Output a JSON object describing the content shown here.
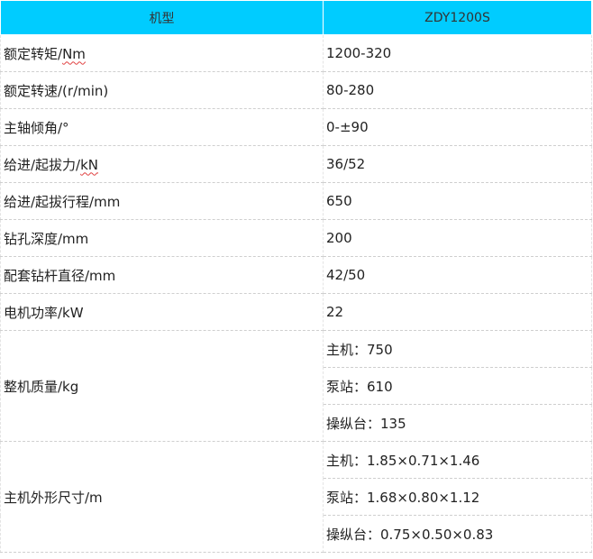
{
  "header": {
    "col1": "机型",
    "col2": "ZDY1200S"
  },
  "rows": [
    {
      "label_prefix": "额定转矩/",
      "label_unit": "Nm",
      "value": "1200-320"
    },
    {
      "label_prefix": "额定转速/(r/min)",
      "value": "80-280"
    },
    {
      "label_prefix": "主轴倾角/°",
      "value": "0-±90"
    },
    {
      "label_prefix": "给进/起拔力/",
      "label_unit": "kN",
      "value": "36/52"
    },
    {
      "label_prefix": "给进/起拔行程/mm",
      "value": "650"
    },
    {
      "label_prefix": "钻孔深度/mm",
      "value": "200"
    },
    {
      "label_prefix": "配套钻杆直径/mm",
      "value": "42/50"
    },
    {
      "label_prefix": "电机功率/kW",
      "value": "22"
    }
  ],
  "mass": {
    "label": "整机质量/kg",
    "values": [
      "主机：750",
      "泵站：610",
      "操纵台：135"
    ]
  },
  "dims": {
    "label": "主机外形尺寸/m",
    "values": [
      "主机：1.85×0.71×1.46",
      "泵站：1.68×0.80×1.12",
      "操纵台：0.75×0.50×0.83"
    ]
  }
}
